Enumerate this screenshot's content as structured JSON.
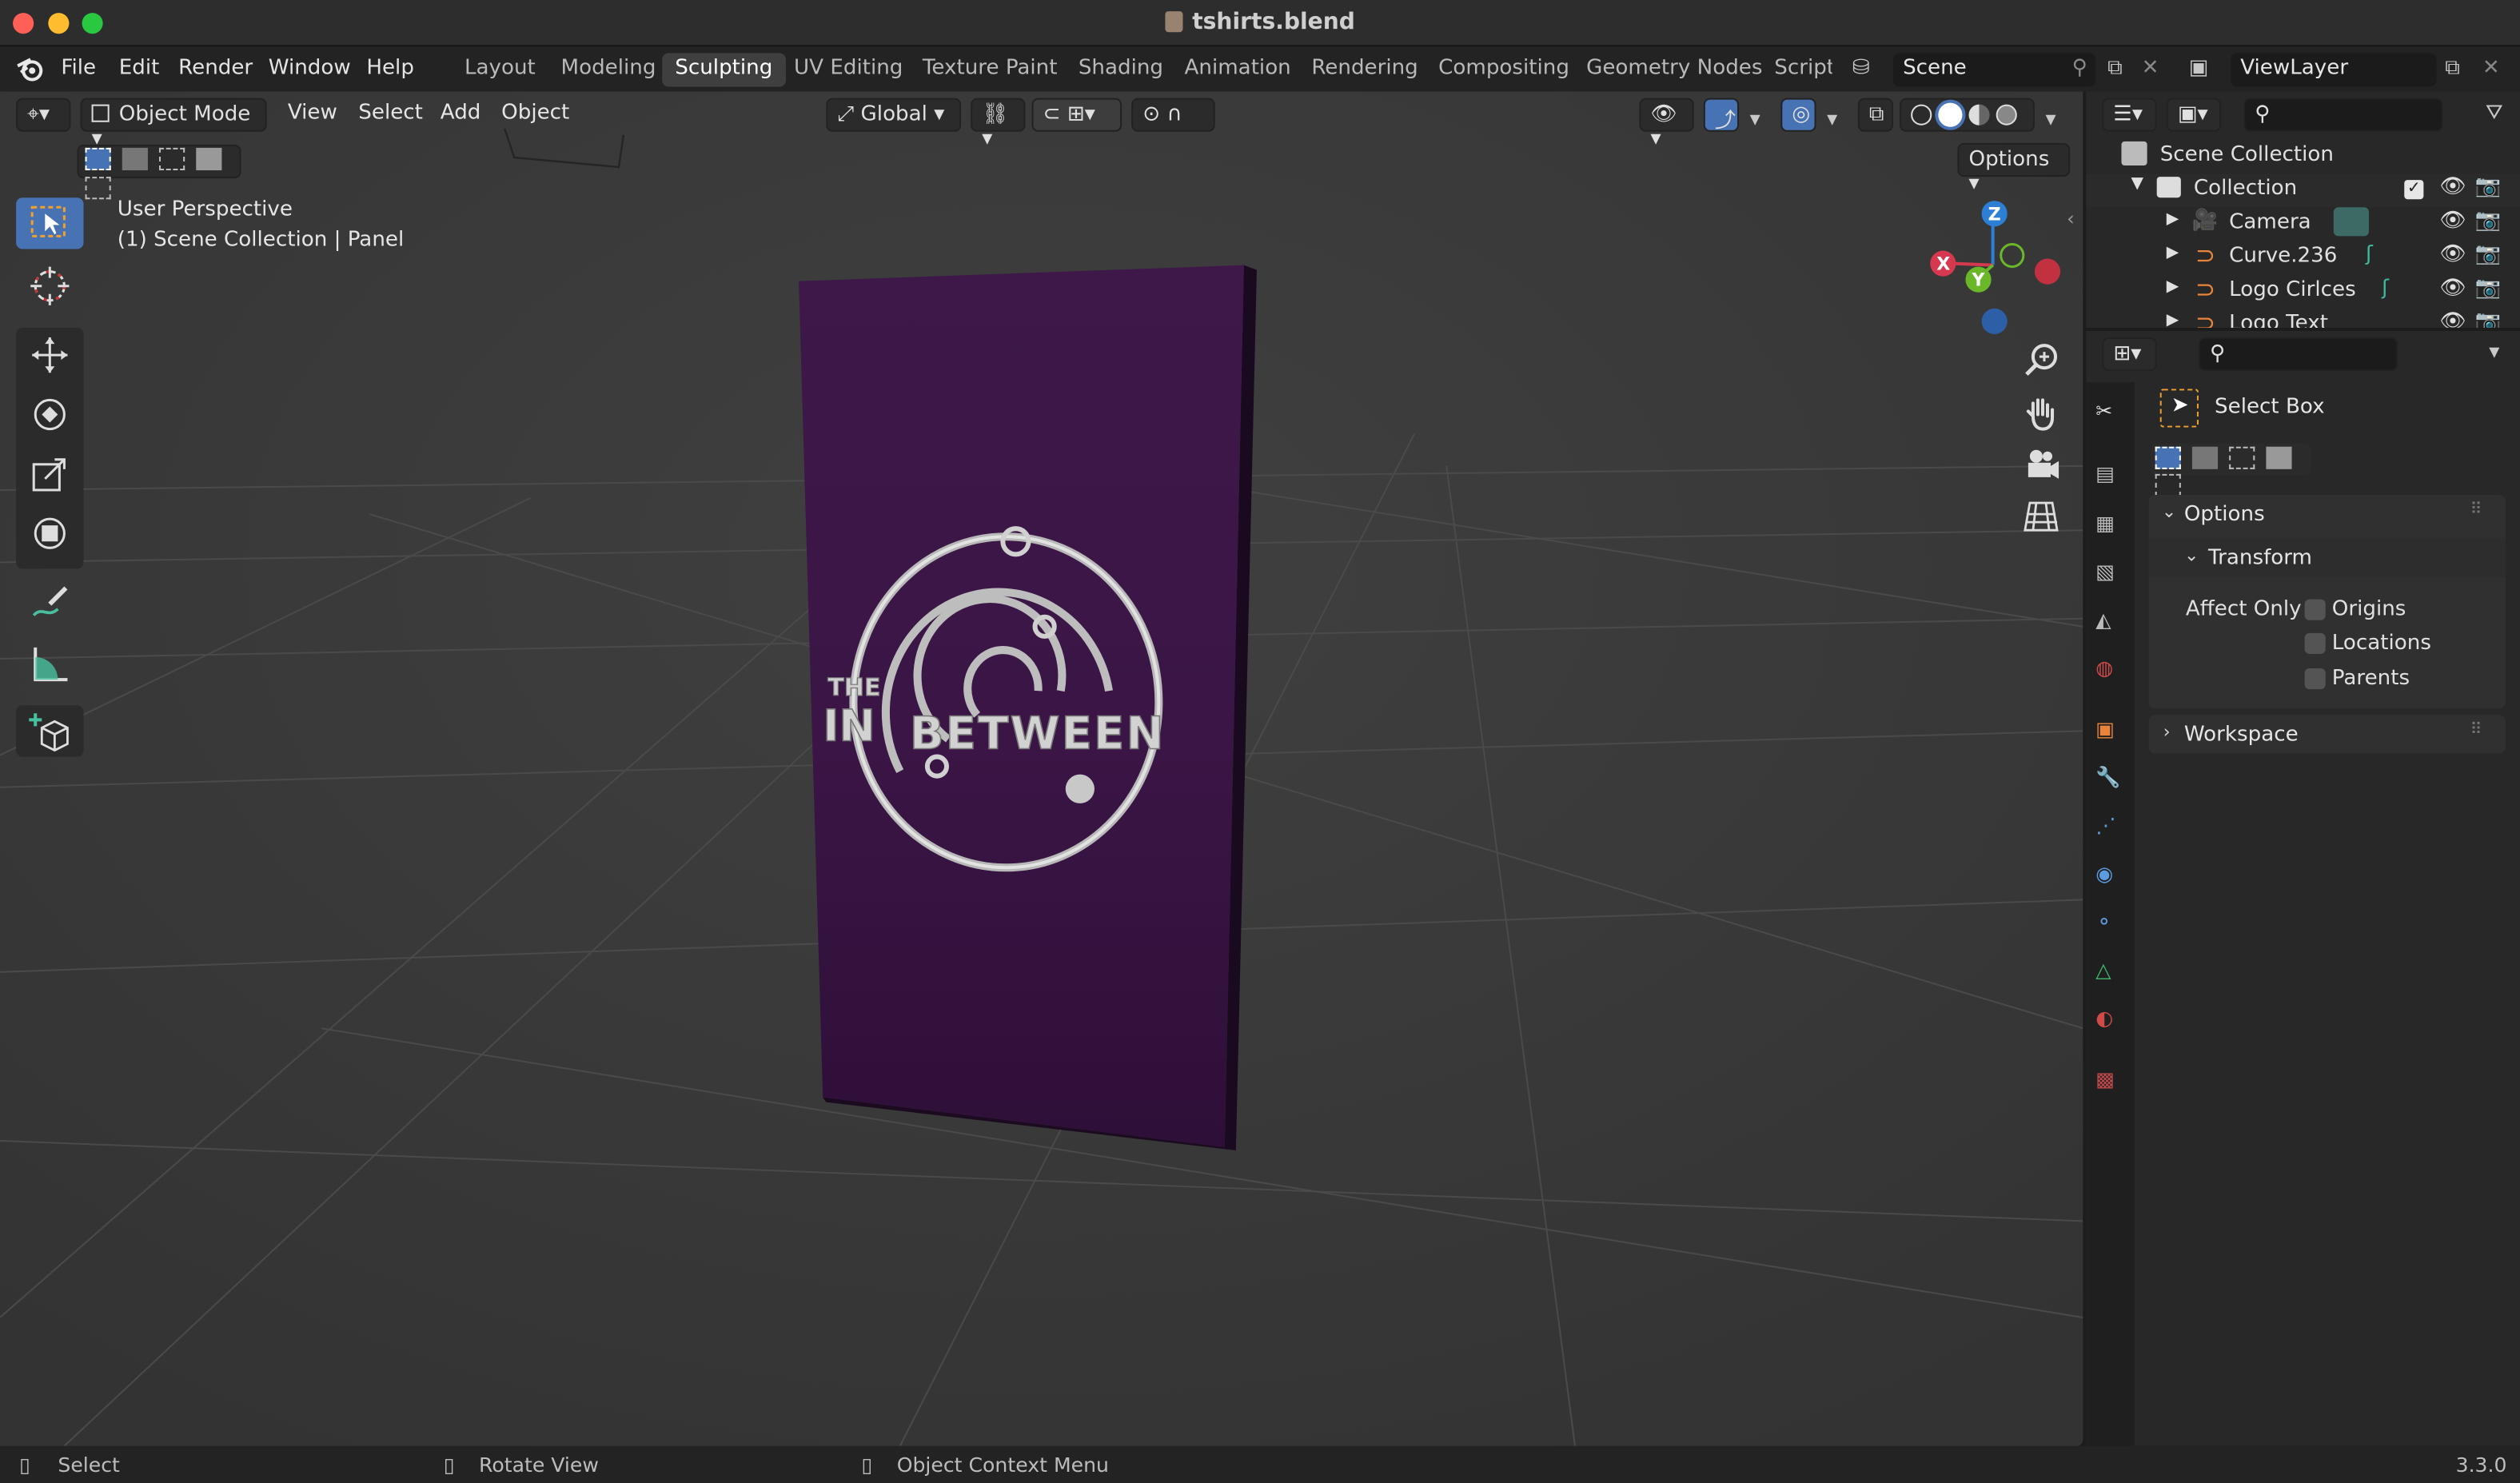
{
  "window": {
    "title": "tshirts.blend"
  },
  "menu": [
    "File",
    "Edit",
    "Render",
    "Window",
    "Help"
  ],
  "workspaces": [
    "Layout",
    "Modeling",
    "Sculpting",
    "UV Editing",
    "Texture Paint",
    "Shading",
    "Animation",
    "Rendering",
    "Compositing",
    "Geometry Nodes",
    "Script"
  ],
  "active_workspace": "Sculpting",
  "scene": {
    "name": "Scene"
  },
  "view_layer": {
    "name": "ViewLayer"
  },
  "viewport": {
    "mode": "Object Mode",
    "menus": [
      "View",
      "Select",
      "Add",
      "Object"
    ],
    "orientation": "Global",
    "options_label": "Options",
    "view_name": "User Perspective",
    "context": "(1) Scene Collection | Panel",
    "gizmo": {
      "x": "X",
      "y": "Y",
      "z": "Z"
    },
    "logo_text": {
      "top": "THE",
      "left": "IN",
      "right": "BETWEEN"
    }
  },
  "outliner": {
    "root": "Scene Collection",
    "collection": "Collection",
    "items": [
      "Camera",
      "Curve.236",
      "Logo Cirlces",
      "Logo Text"
    ]
  },
  "properties": {
    "tool_name": "Select Box",
    "options_label": "Options",
    "transform_label": "Transform",
    "affect_only_label": "Affect Only",
    "checkboxes": [
      "Origins",
      "Locations",
      "Parents"
    ],
    "workspace_label": "Workspace"
  },
  "status": {
    "left": "Select",
    "middle": "Rotate View",
    "right": "Object Context Menu",
    "version": "3.3.0"
  },
  "colors": {
    "accent": "#4772b3",
    "panel_purple": "#3c1646",
    "background": "#3a3a3a"
  }
}
